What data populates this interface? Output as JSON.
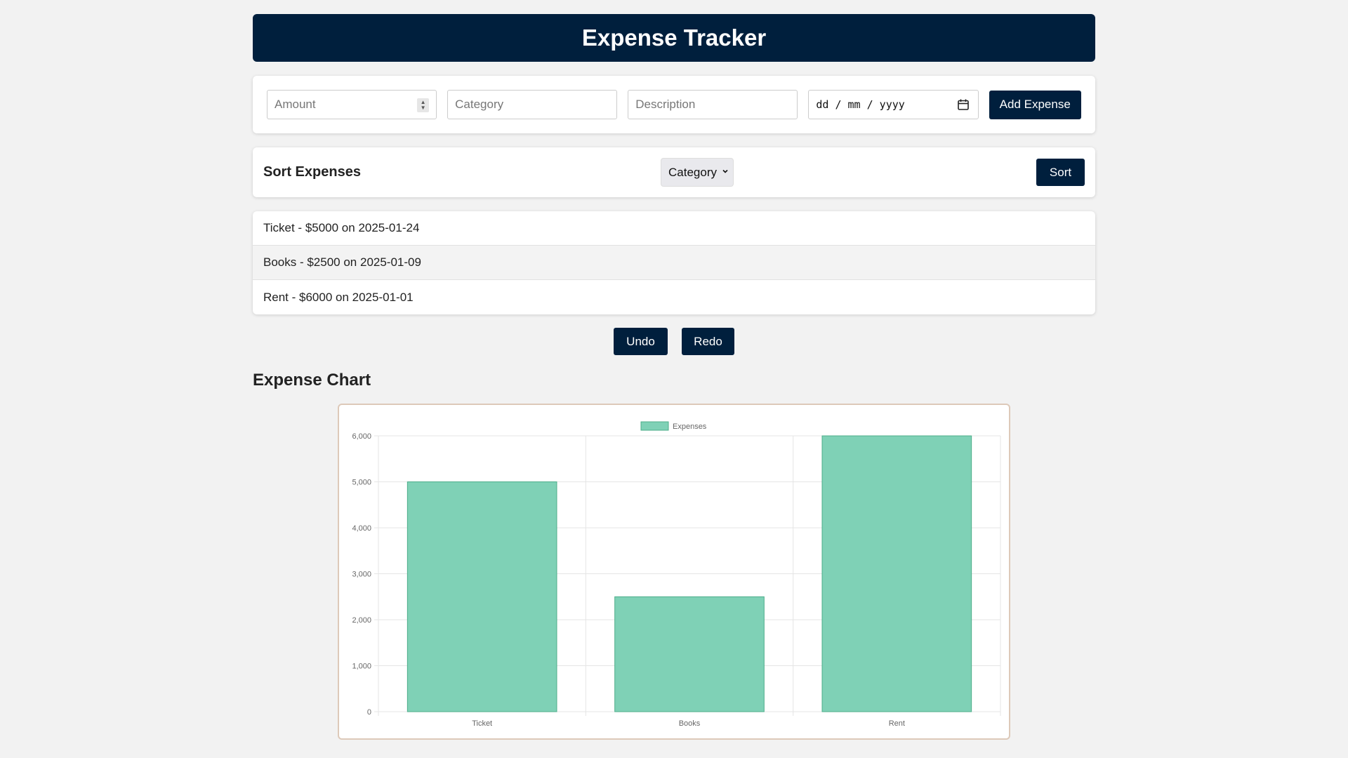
{
  "header": {
    "title": "Expense Tracker"
  },
  "form": {
    "amount_placeholder": "Amount",
    "category_placeholder": "Category",
    "description_placeholder": "Description",
    "date_placeholder": "dd / mm / yyyy",
    "add_label": "Add Expense"
  },
  "sort": {
    "title": "Sort Expenses",
    "selected": "Category",
    "button_label": "Sort"
  },
  "expenses": [
    {
      "text": "Ticket - $5000 on 2025-01-24"
    },
    {
      "text": "Books - $2500 on 2025-01-09"
    },
    {
      "text": "Rent - $6000 on 2025-01-01"
    }
  ],
  "actions": {
    "undo_label": "Undo",
    "redo_label": "Redo"
  },
  "chart_section": {
    "title": "Expense Chart"
  },
  "colors": {
    "accent": "#001f3d",
    "bar_fill": "#7fd1b6",
    "bar_stroke": "#4cae8a"
  },
  "chart_data": {
    "type": "bar",
    "categories": [
      "Ticket",
      "Books",
      "Rent"
    ],
    "series": [
      {
        "name": "Expenses",
        "values": [
          5000,
          2500,
          6000
        ]
      }
    ],
    "ylim": [
      0,
      6000
    ],
    "yticks": [
      "0",
      "1,000",
      "2,000",
      "3,000",
      "4,000",
      "5,000",
      "6,000"
    ],
    "grid": true,
    "legend": "top-center"
  }
}
